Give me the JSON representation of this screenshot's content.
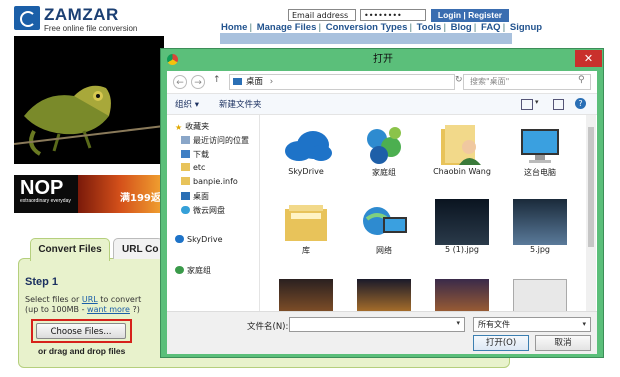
{
  "site": {
    "logo_text": "ZAMZAR",
    "tagline": "Free online file conversion",
    "email_placeholder": "Email address",
    "password_mask": "••••••••",
    "login_label": "Login | Register",
    "nav": [
      "Home",
      "Manage Files",
      "Conversion Types",
      "Tools",
      "Blog",
      "FAQ",
      "Signup"
    ],
    "ad_nop": "NOP",
    "ad_nop_sub": "extraordinary everyday",
    "ad_text": "满199返",
    "tabs": [
      "Convert Files",
      "URL Co"
    ],
    "step_title": "Step 1",
    "step_line1_a": "Select files or ",
    "step_line1_link": "URL",
    "step_line1_b": " to convert",
    "step_line2_a": "(up to 100MB - ",
    "step_line2_link": "want more",
    "step_line2_b": " ?)",
    "choose_label": "Choose Files...",
    "drag_label": "or drag and drop files"
  },
  "dialog": {
    "title": "打开",
    "close": "✕",
    "address": "桌面",
    "address_chevron": "›",
    "search_placeholder": "搜索\"桌面\"",
    "toolbar": {
      "organize": "组织 ▾",
      "new_folder": "新建文件夹"
    },
    "sidebar": [
      {
        "label": "收藏夹",
        "icon": "star-icon"
      },
      {
        "label": "最近访问的位置",
        "icon": "recent-icon"
      },
      {
        "label": "下载",
        "icon": "download-icon"
      },
      {
        "label": "etc",
        "icon": "folder-icon"
      },
      {
        "label": "banpie.info",
        "icon": "folder-icon"
      },
      {
        "label": "桌面",
        "icon": "desktop-icon"
      },
      {
        "label": "微云网盘",
        "icon": "cloud-disk-icon"
      },
      {
        "label": "SkyDrive",
        "icon": "skydrive-icon"
      },
      {
        "label": "家庭组",
        "icon": "homegroup-icon"
      }
    ],
    "items": [
      {
        "label": "SkyDrive",
        "icon": "skydrive-icon"
      },
      {
        "label": "家庭组",
        "icon": "homegroup-icon"
      },
      {
        "label": "Chaobin Wang",
        "icon": "user-folder-icon"
      },
      {
        "label": "这台电脑",
        "icon": "computer-icon"
      },
      {
        "label": "库",
        "icon": "library-icon"
      },
      {
        "label": "网络",
        "icon": "network-icon"
      },
      {
        "label": "5 (1).jpg",
        "icon": "image-thumb-icon"
      },
      {
        "label": "5.jpg",
        "icon": "image-thumb-icon"
      },
      {
        "label": "",
        "icon": "image-thumb-icon"
      },
      {
        "label": "",
        "icon": "image-thumb-icon"
      },
      {
        "label": "",
        "icon": "image-thumb-icon"
      },
      {
        "label": "",
        "icon": "image-thumb-icon"
      }
    ],
    "filename_label": "文件名(N):",
    "filetype": "所有文件",
    "open_label": "打开(O)",
    "cancel_label": "取消"
  }
}
